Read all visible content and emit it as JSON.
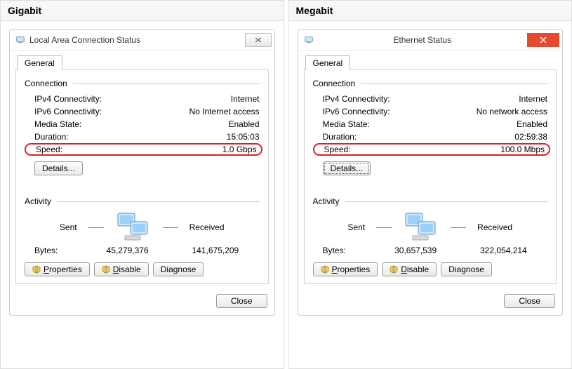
{
  "panels": [
    {
      "header": "Gigabit",
      "title": "Local Area Connection Status",
      "closeStyle": "classic",
      "tab": "General",
      "connection": {
        "label": "Connection",
        "ipv4_k": "IPv4 Connectivity:",
        "ipv4_v": "Internet",
        "ipv6_k": "IPv6 Connectivity:",
        "ipv6_v": "No Internet access",
        "media_k": "Media State:",
        "media_v": "Enabled",
        "dur_k": "Duration:",
        "dur_v": "15:05:03",
        "speed_k": "Speed:",
        "speed_v": "1.0 Gbps"
      },
      "details": "Details...",
      "detailsDotted": false,
      "activity": {
        "label": "Activity",
        "sent_label": "Sent",
        "recv_label": "Received",
        "bytes_label": "Bytes:",
        "sent": "45,279,376",
        "recv": "141,675,209"
      },
      "buttons": {
        "properties": "Properties",
        "disable": "Disable",
        "diagnose": "Diagnose",
        "close": "Close"
      }
    },
    {
      "header": "Megabit",
      "title": "Ethernet Status",
      "closeStyle": "red",
      "tab": "General",
      "connection": {
        "label": "Connection",
        "ipv4_k": "IPv4 Connectivity:",
        "ipv4_v": "Internet",
        "ipv6_k": "IPv6 Connectivity:",
        "ipv6_v": "No network access",
        "media_k": "Media State:",
        "media_v": "Enabled",
        "dur_k": "Duration:",
        "dur_v": "02:59:38",
        "speed_k": "Speed:",
        "speed_v": "100.0 Mbps"
      },
      "details": "Details...",
      "detailsDotted": true,
      "activity": {
        "label": "Activity",
        "sent_label": "Sent",
        "recv_label": "Received",
        "bytes_label": "Bytes:",
        "sent": "30,657,539",
        "recv": "322,054,214"
      },
      "buttons": {
        "properties": "Properties",
        "disable": "Disable",
        "diagnose": "Diagnose",
        "close": "Close"
      }
    }
  ]
}
